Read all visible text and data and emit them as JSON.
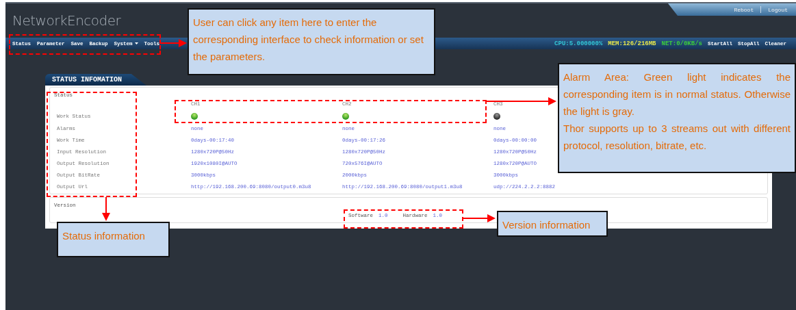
{
  "header": {
    "logo": "NetworkEncoder",
    "links": [
      "Reboot",
      "Logout"
    ]
  },
  "navbar": {
    "items": [
      {
        "label": "Status",
        "has_menu": false
      },
      {
        "label": "Parameter",
        "has_menu": false
      },
      {
        "label": "Save",
        "has_menu": false
      },
      {
        "label": "Backup",
        "has_menu": false
      },
      {
        "label": "System",
        "has_menu": true
      },
      {
        "label": "Tools",
        "has_menu": false
      }
    ],
    "stats": [
      {
        "text": "CPU:5.000000%",
        "color": "#33c6d6"
      },
      {
        "text": "MEM:126/216MB",
        "color": "#e6e64a"
      },
      {
        "text": "NET:0/0KB/s",
        "color": "#3ccc3c"
      }
    ],
    "actions": [
      "StartAll",
      "StopAll",
      "Cleaner"
    ]
  },
  "panel": {
    "tab": "STATUS INFOMATION",
    "status": {
      "legend": "Status",
      "channels": [
        {
          "name": "CH1",
          "on": true
        },
        {
          "name": "CH2",
          "on": true
        },
        {
          "name": "CH3",
          "on": false
        }
      ],
      "work_status_label": "Work Status",
      "rows": [
        {
          "label": "Alarms",
          "values": [
            "none",
            "none",
            "none"
          ]
        },
        {
          "label": "Work Time",
          "values": [
            "0days-00:17:40",
            "0days-00:17:26",
            "0days-00:00:00"
          ]
        },
        {
          "label": "Input Resolution",
          "values": [
            "1280x720P@50Hz",
            "1280x720P@50Hz",
            "1280x720P@50Hz"
          ]
        },
        {
          "label": "Output Resolution",
          "values": [
            "1920x1080I@AUTO",
            "720x576I@AUTO",
            "1280x720P@AUTO"
          ]
        },
        {
          "label": "Output BitRate",
          "values": [
            "3000kbps",
            "2000kbps",
            "3000kbps"
          ]
        },
        {
          "label": "Output Url",
          "values": [
            "http://192.168.200.69:8080/output0.m3u8",
            "http://192.168.200.69:8080/output1.m3u8",
            "udp://224.2.2.2:8882"
          ]
        }
      ]
    },
    "version": {
      "legend": "Version",
      "items": [
        {
          "label": "Software",
          "value": "1.0"
        },
        {
          "label": "Hardware",
          "value": "1.0"
        }
      ]
    }
  },
  "annotations": [
    {
      "paragraphs": [
        "User can click any item here to enter the corresponding interface to check information or set the parameters."
      ]
    },
    {
      "paragraphs": [
        "Alarm Area: Green light indicates the corresponding item is in normal status. Otherwise the light is gray.",
        "Thor supports up to 3 streams out with different protocol, resolution, bitrate, etc."
      ]
    },
    {
      "paragraphs": [
        "Status information"
      ]
    },
    {
      "paragraphs": [
        "Version information"
      ]
    }
  ]
}
